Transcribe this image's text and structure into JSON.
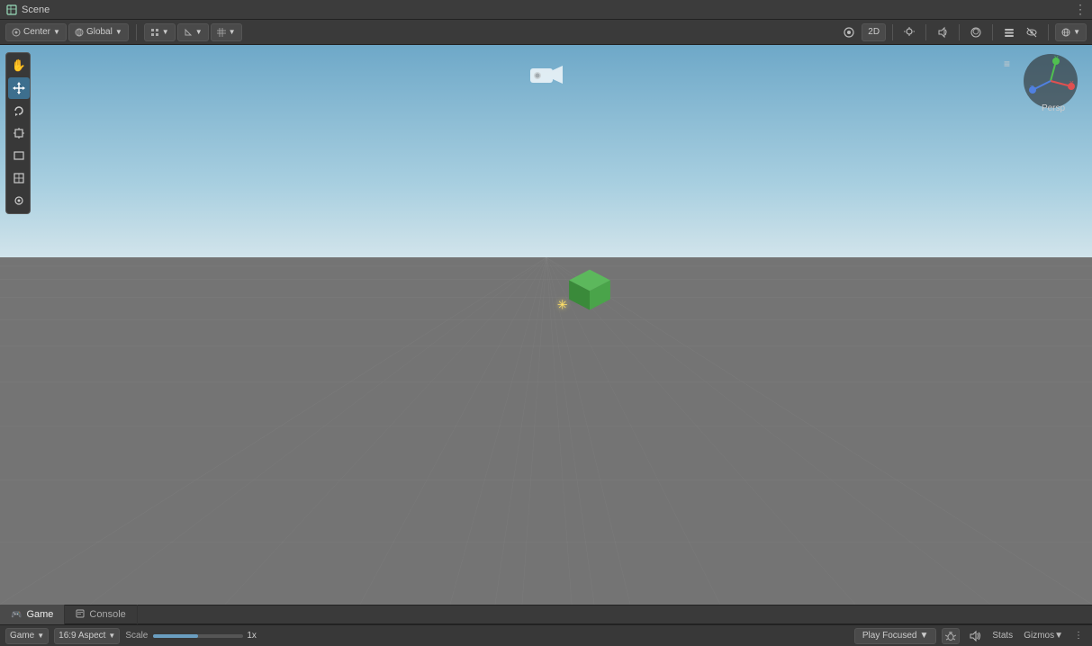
{
  "titleBar": {
    "title": "Scene",
    "icon": "scene-icon"
  },
  "toolbar": {
    "centerLabel": "Center",
    "globalLabel": "Global",
    "snapBtn": "snap-icon",
    "2dLabel": "2D",
    "buttons": [
      "center-dropdown",
      "global-dropdown",
      "snap-group",
      "snap-angle"
    ],
    "rightIcons": [
      "persp-icon",
      "2d-btn",
      "light-icon",
      "audio-icon",
      "fx-icon",
      "layer-icon",
      "eye-slash-icon",
      "grid-icon",
      "view-btn"
    ]
  },
  "tools": {
    "items": [
      {
        "name": "hand-tool",
        "icon": "✋",
        "active": false
      },
      {
        "name": "move-tool",
        "icon": "✥",
        "active": true
      },
      {
        "name": "rotate-tool",
        "icon": "↺",
        "active": false
      },
      {
        "name": "scale-tool",
        "icon": "⊡",
        "active": false
      },
      {
        "name": "rect-tool",
        "icon": "⬜",
        "active": false
      },
      {
        "name": "transform-tool",
        "icon": "⊞",
        "active": false
      },
      {
        "name": "custom-tool",
        "icon": "◉",
        "active": false
      }
    ]
  },
  "scene": {
    "perspLabel": "Persp",
    "cameraIcon": "🎥"
  },
  "gizmo": {
    "label": "Persp",
    "xColor": "#e05050",
    "yColor": "#50c050",
    "zColor": "#5080e0"
  },
  "bottomTabs": [
    {
      "id": "game",
      "label": "Game",
      "icon": "🎮",
      "active": true
    },
    {
      "id": "console",
      "label": "Console",
      "icon": "☰",
      "active": false
    }
  ],
  "bottomControls": {
    "gameDropdown": "Game",
    "gameDropdownArrow": "▼",
    "aspectLabel": "16:9 Aspect",
    "aspectArrow": "▼",
    "scaleLabel": "Scale",
    "scaleValue": "1x",
    "playFocusedLabel": "Play Focused",
    "playFocusedArrow": "▼",
    "bugIcon": "🐛",
    "rightButtons": {
      "muteIcon": "🔊",
      "statsLabel": "Stats",
      "gizmosLabel": "Gizmos",
      "gizmosArrow": "▼",
      "kebabIcon": "⋮"
    }
  }
}
